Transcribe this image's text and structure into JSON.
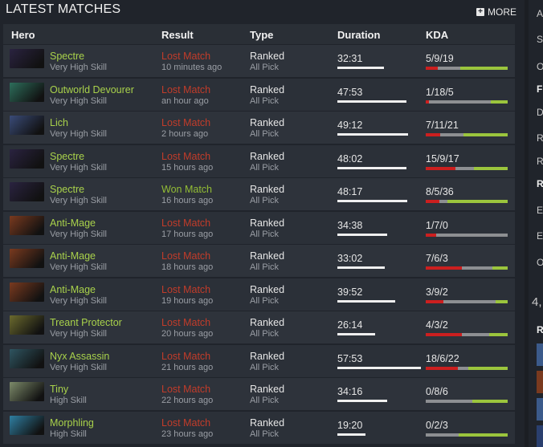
{
  "header": {
    "title": "LATEST MATCHES",
    "more_label": "MORE",
    "more_icon": "plus-icon"
  },
  "columns": {
    "hero": "Hero",
    "result": "Result",
    "type": "Type",
    "duration": "Duration",
    "kda": "KDA"
  },
  "rows": [
    {
      "hero": "Spectre",
      "skill": "Very High Skill",
      "result": "Lost Match",
      "won": false,
      "time": "10 minutes ago",
      "type": "Ranked",
      "mode": "All Pick",
      "duration": "32:31",
      "duration_min": 32.5,
      "kda": "5/9/19",
      "k": 5,
      "d": 9,
      "a": 19,
      "hero_color": "#2a2340"
    },
    {
      "hero": "Outworld Devourer",
      "skill": "Very High Skill",
      "result": "Lost Match",
      "won": false,
      "time": "an hour ago",
      "type": "Ranked",
      "mode": "All Pick",
      "duration": "47:53",
      "duration_min": 47.9,
      "kda": "1/18/5",
      "k": 1,
      "d": 18,
      "a": 5,
      "hero_color": "#2d6e5b"
    },
    {
      "hero": "Lich",
      "skill": "Very High Skill",
      "result": "Lost Match",
      "won": false,
      "time": "2 hours ago",
      "type": "Ranked",
      "mode": "All Pick",
      "duration": "49:12",
      "duration_min": 49.2,
      "kda": "7/11/21",
      "k": 7,
      "d": 11,
      "a": 21,
      "hero_color": "#3a4b78"
    },
    {
      "hero": "Spectre",
      "skill": "Very High Skill",
      "result": "Lost Match",
      "won": false,
      "time": "15 hours ago",
      "type": "Ranked",
      "mode": "All Pick",
      "duration": "48:02",
      "duration_min": 48.0,
      "kda": "15/9/17",
      "k": 15,
      "d": 9,
      "a": 17,
      "hero_color": "#2a2340"
    },
    {
      "hero": "Spectre",
      "skill": "Very High Skill",
      "result": "Won Match",
      "won": true,
      "time": "16 hours ago",
      "type": "Ranked",
      "mode": "All Pick",
      "duration": "48:17",
      "duration_min": 48.3,
      "kda": "8/5/36",
      "k": 8,
      "d": 5,
      "a": 36,
      "hero_color": "#2a2340"
    },
    {
      "hero": "Anti-Mage",
      "skill": "Very High Skill",
      "result": "Lost Match",
      "won": false,
      "time": "17 hours ago",
      "type": "Ranked",
      "mode": "All Pick",
      "duration": "34:38",
      "duration_min": 34.6,
      "kda": "1/7/0",
      "k": 1,
      "d": 7,
      "a": 0,
      "hero_color": "#7a3a1f"
    },
    {
      "hero": "Anti-Mage",
      "skill": "Very High Skill",
      "result": "Lost Match",
      "won": false,
      "time": "18 hours ago",
      "type": "Ranked",
      "mode": "All Pick",
      "duration": "33:02",
      "duration_min": 33.0,
      "kda": "7/6/3",
      "k": 7,
      "d": 6,
      "a": 3,
      "hero_color": "#7a3a1f"
    },
    {
      "hero": "Anti-Mage",
      "skill": "Very High Skill",
      "result": "Lost Match",
      "won": false,
      "time": "19 hours ago",
      "type": "Ranked",
      "mode": "All Pick",
      "duration": "39:52",
      "duration_min": 39.9,
      "kda": "3/9/2",
      "k": 3,
      "d": 9,
      "a": 2,
      "hero_color": "#7a3a1f"
    },
    {
      "hero": "Treant Protector",
      "skill": "Very High Skill",
      "result": "Lost Match",
      "won": false,
      "time": "20 hours ago",
      "type": "Ranked",
      "mode": "All Pick",
      "duration": "26:14",
      "duration_min": 26.2,
      "kda": "4/3/2",
      "k": 4,
      "d": 3,
      "a": 2,
      "hero_color": "#6b6a2e"
    },
    {
      "hero": "Nyx Assassin",
      "skill": "Very High Skill",
      "result": "Lost Match",
      "won": false,
      "time": "21 hours ago",
      "type": "Ranked",
      "mode": "All Pick",
      "duration": "57:53",
      "duration_min": 57.9,
      "kda": "18/6/22",
      "k": 18,
      "d": 6,
      "a": 22,
      "hero_color": "#2f5561"
    },
    {
      "hero": "Tiny",
      "skill": "High Skill",
      "result": "Lost Match",
      "won": false,
      "time": "22 hours ago",
      "type": "Ranked",
      "mode": "All Pick",
      "duration": "34:16",
      "duration_min": 34.3,
      "kda": "0/8/6",
      "k": 0,
      "d": 8,
      "a": 6,
      "hero_color": "#7d8b6a"
    },
    {
      "hero": "Morphling",
      "skill": "High Skill",
      "result": "Lost Match",
      "won": false,
      "time": "23 hours ago",
      "type": "Ranked",
      "mode": "All Pick",
      "duration": "19:20",
      "duration_min": 19.3,
      "kda": "0/2/3",
      "k": 0,
      "d": 2,
      "a": 3,
      "hero_color": "#2f7fa2"
    }
  ],
  "sidebar_fragments": [
    "A",
    "S",
    "O",
    "F",
    "D",
    "R",
    "R",
    "R",
    "E",
    "E",
    "O",
    "4,",
    "R"
  ],
  "colors": {
    "won": "#93bd35",
    "lost": "#c23c2a",
    "hero_name": "#a9d24b",
    "kills": "#cc1f1f",
    "deaths": "#8d8f92",
    "assists": "#9bc53d"
  }
}
